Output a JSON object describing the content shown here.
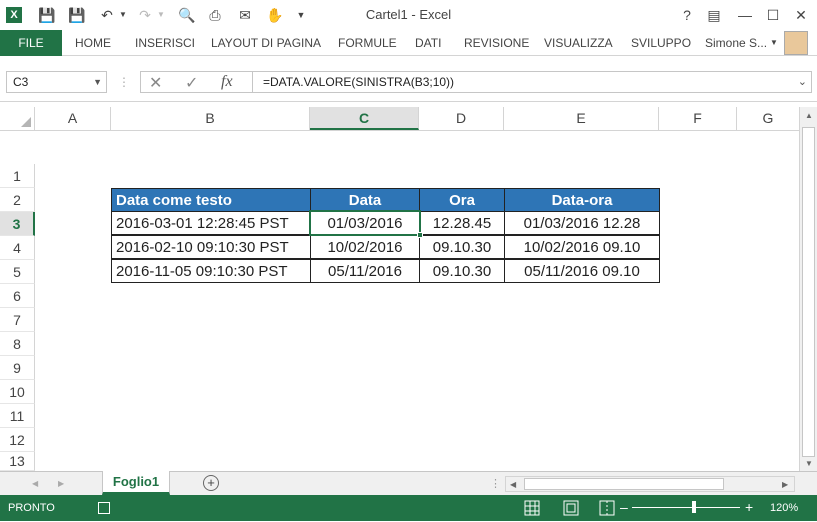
{
  "window": {
    "title": "Cartel1 - Excel"
  },
  "ribbon": {
    "file_label": "FILE",
    "tabs": [
      "HOME",
      "INSERISCI",
      "LAYOUT DI PAGINA",
      "FORMULE",
      "DATI",
      "REVISIONE",
      "VISUALIZZA",
      "SVILUPPO"
    ],
    "user_name": "Simone S..."
  },
  "formula_bar": {
    "name_box": "C3",
    "formula": "=DATA.VALORE(SINISTRA(B3;10))"
  },
  "columns": [
    "A",
    "B",
    "C",
    "D",
    "E",
    "F",
    "G"
  ],
  "selected_column": "C",
  "rows": [
    "1",
    "2",
    "3",
    "4",
    "5",
    "6",
    "7",
    "8",
    "9",
    "10",
    "11",
    "12",
    "13"
  ],
  "selected_row": "3",
  "table": {
    "headers": [
      "Data come testo",
      "Data",
      "Ora",
      "Data-ora"
    ],
    "rows": [
      [
        "2016-03-01 12:28:45 PST",
        "01/03/2016",
        "12.28.45",
        "01/03/2016 12.28"
      ],
      [
        "2016-02-10 09:10:30 PST",
        "10/02/2016",
        "09.10.30",
        "10/02/2016 09.10"
      ],
      [
        "2016-11-05 09:10:30 PST",
        "05/11/2016",
        "09.10.30",
        "05/11/2016 09.10"
      ]
    ]
  },
  "sheet_tabs": [
    "Foglio1"
  ],
  "status": {
    "text": "PRONTO",
    "zoom": "120%"
  },
  "colors": {
    "accent": "#217346",
    "table_header": "#2e75b6"
  }
}
